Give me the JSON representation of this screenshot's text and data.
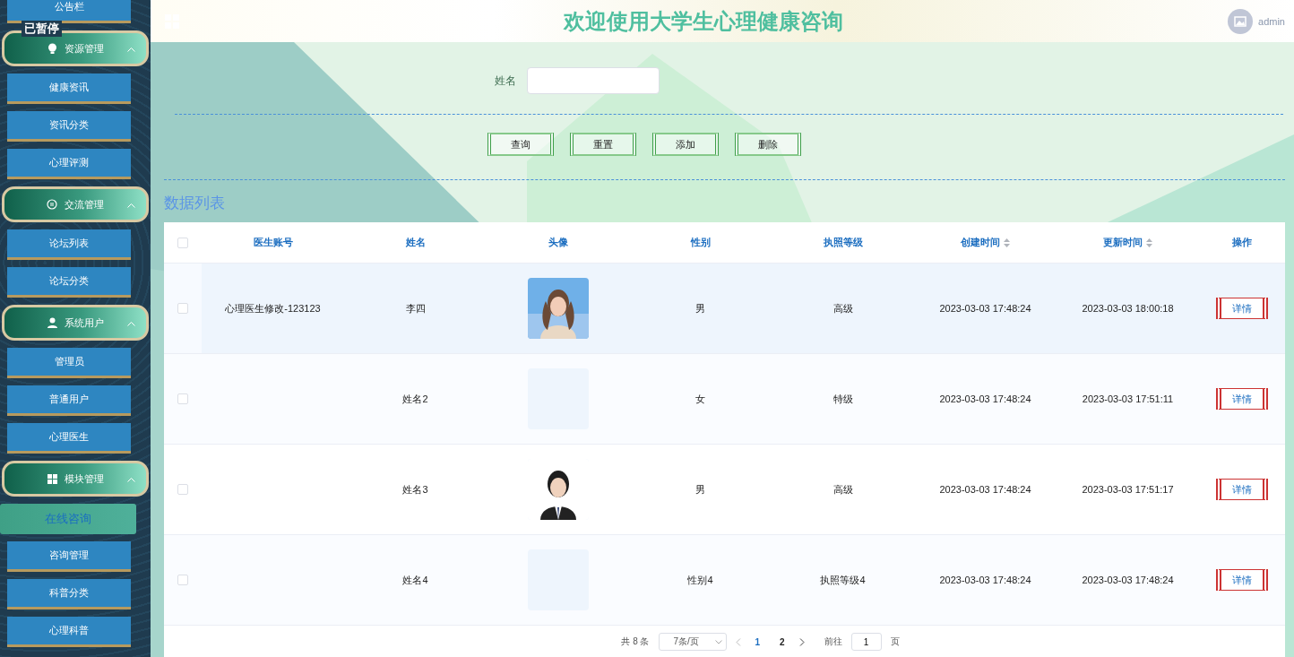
{
  "paused_label": "已暂停",
  "sidebar": {
    "groups": [
      {
        "items": [
          {
            "label": "公告栏",
            "selected": false
          }
        ]
      },
      {
        "title": "资源管理",
        "expanded": true,
        "items": [
          {
            "label": "健康资讯",
            "selected": false
          },
          {
            "label": "资讯分类",
            "selected": false
          },
          {
            "label": "心理评测",
            "selected": false
          }
        ]
      },
      {
        "title": "交流管理",
        "expanded": true,
        "items": [
          {
            "label": "论坛列表",
            "selected": false
          },
          {
            "label": "论坛分类",
            "selected": false
          }
        ]
      },
      {
        "title": "系统用户",
        "expanded": true,
        "items": [
          {
            "label": "管理员",
            "selected": false
          },
          {
            "label": "普通用户",
            "selected": false
          },
          {
            "label": "心理医生",
            "selected": false
          }
        ]
      },
      {
        "title": "模块管理",
        "expanded": true,
        "items": [
          {
            "label": "在线咨询",
            "selected": true
          },
          {
            "label": "咨询管理",
            "selected": false
          },
          {
            "label": "科普分类",
            "selected": false
          },
          {
            "label": "心理科普",
            "selected": false
          }
        ]
      }
    ]
  },
  "header": {
    "title": "欢迎使用大学生心理健康咨询",
    "user": "admin"
  },
  "search": {
    "label": "姓名"
  },
  "buttons": [
    "查询",
    "重置",
    "添加",
    "删除"
  ],
  "section_title": "数据列表",
  "table": {
    "all_checked": false,
    "columns": [
      {
        "label": "医生账号",
        "sortable": false
      },
      {
        "label": "姓名",
        "sortable": false
      },
      {
        "label": "头像",
        "sortable": false
      },
      {
        "label": "性别",
        "sortable": false
      },
      {
        "label": "执照等级",
        "sortable": false
      },
      {
        "label": "创建时间",
        "sortable": true
      },
      {
        "label": "更新时间",
        "sortable": true
      },
      {
        "label": "操作",
        "sortable": false
      }
    ],
    "rows": [
      {
        "checked": false,
        "highlighted": true,
        "account": "心理医生修改-123123",
        "name": "李四",
        "gender": "男",
        "level": "高级",
        "created": "2023-03-03 17:48:24",
        "updated": "2023-03-03 18:00:18",
        "action": "详情"
      },
      {
        "checked": false,
        "highlighted": false,
        "name": "姓名2",
        "avatar": {
          "kind": "placeholder"
        },
        "gender": "女",
        "level": "特级",
        "created": "2023-03-03 17:48:24",
        "updated": "2023-03-03 17:51:11",
        "action": "详情"
      },
      {
        "checked": false,
        "highlighted": false,
        "name": "姓名3",
        "gender": "男",
        "level": "高级",
        "created": "2023-03-03 17:48:24",
        "updated": "2023-03-03 17:51:17",
        "action": "详情"
      },
      {
        "checked": false,
        "highlighted": false,
        "name": "姓名4",
        "avatar": {
          "kind": "placeholder"
        },
        "gender": "性别4",
        "level": "执照等级4",
        "created": "2023-03-03 17:48:24",
        "updated": "2023-03-03 17:48:24",
        "action": "详情"
      }
    ]
  },
  "pagination": {
    "total": "共 8 条",
    "page_size": "7条/页",
    "pages": [
      {
        "label": "1",
        "selected": true
      },
      {
        "label": "2",
        "selected": false
      }
    ],
    "goto_label": "前往",
    "goto_value": "1",
    "goto_suffix": "页"
  }
}
